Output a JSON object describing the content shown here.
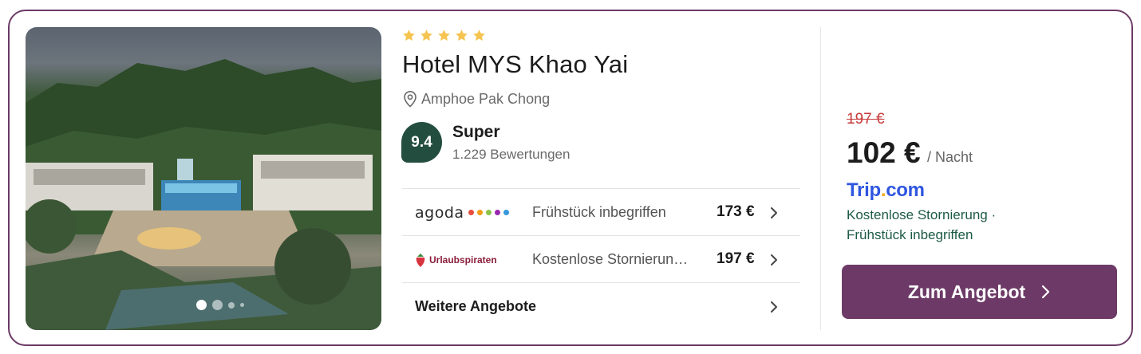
{
  "hotel": {
    "stars": 5,
    "name": "Hotel MYS Khao Yai",
    "location": "Amphoe Pak Chong",
    "rating": {
      "score": "9.4",
      "label": "Super",
      "reviews": "1.229 Bewertungen"
    },
    "photo": {
      "icon": "hotel-photo",
      "carousel_dots": 4,
      "active_dot": 0
    }
  },
  "offers": [
    {
      "provider": "agoda",
      "provider_dot_colors": [
        "#e74c3c",
        "#f39c12",
        "#8bc34a",
        "#9c27b0",
        "#3498db"
      ],
      "description": "Frühstück inbegriffen",
      "price": "173 €"
    },
    {
      "provider": "Urlaubspiraten",
      "description": "Kostenlose Stornierun…",
      "price": "197 €"
    }
  ],
  "more_offers_label": "Weitere Angebote",
  "deal": {
    "old_price": "197 €",
    "price": "102 €",
    "per_night": "/ Nacht",
    "provider_name_a": "Trip",
    "provider_name_dot": ".",
    "provider_name_b": "com",
    "benefit_1": "Kostenlose Stornierung ·",
    "benefit_2": "Frühstück inbegriffen",
    "cta_label": "Zum Angebot"
  },
  "colors": {
    "brand": "#6d3a67",
    "rating_badge": "#234d3f",
    "star": "#f5c451",
    "old_price": "#c73a3a",
    "benefit_text": "#1c5a44",
    "tripcom_blue": "#2f56e0"
  }
}
